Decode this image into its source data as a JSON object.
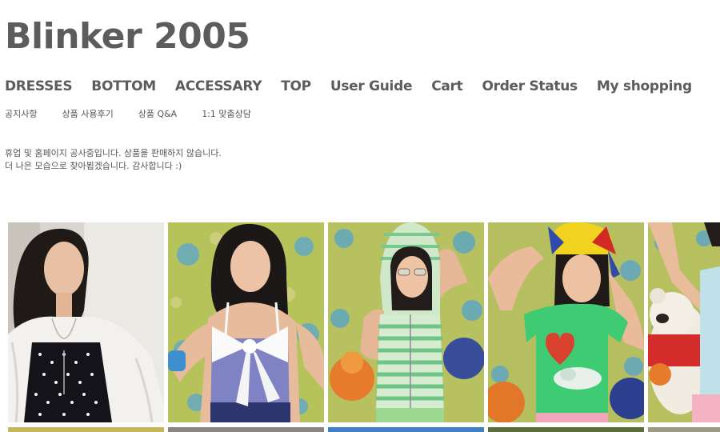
{
  "site": {
    "logo": "Blinker 2005"
  },
  "main_nav": [
    {
      "label": "DRESSES"
    },
    {
      "label": "BOTTOM"
    },
    {
      "label": "ACCESSARY"
    },
    {
      "label": "TOP"
    },
    {
      "label": "User Guide"
    },
    {
      "label": "Cart"
    },
    {
      "label": "Order Status"
    },
    {
      "label": "My shopping"
    }
  ],
  "sub_nav": [
    {
      "label": "공지사항"
    },
    {
      "label": "상품 사용후기"
    },
    {
      "label": "상품 Q&A"
    },
    {
      "label": "1:1 맞춤상담"
    }
  ],
  "notice": {
    "line1": "휴업 및 홈페이지 공사중입니다. 상품을 판매하지 않습니다.",
    "line2": "더 나은 모습으로 찾아뵙겠습니다. 감사합니다 :)"
  },
  "gallery": {
    "items": [
      {
        "icon": "product-photo-white-cardigan-polka-dot-dress"
      },
      {
        "icon": "product-photo-white-bow-tube-top"
      },
      {
        "icon": "product-photo-green-striped-hoodie"
      },
      {
        "icon": "product-photo-green-heart-tshirt"
      },
      {
        "icon": "product-photo-light-blue-top"
      }
    ]
  }
}
